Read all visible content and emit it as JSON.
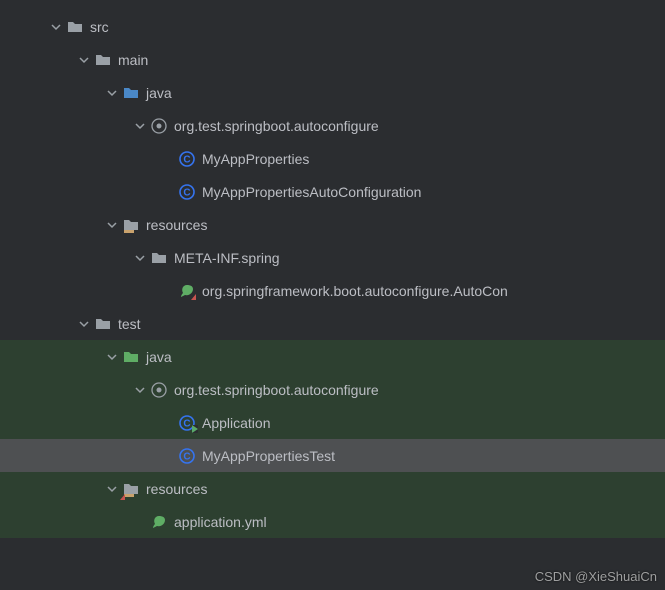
{
  "tree": {
    "src": "src",
    "main": "main",
    "main_java": "java",
    "main_pkg": "org.test.springboot.autoconfigure",
    "class_myappprops": "MyAppProperties",
    "class_myappautoconfig": "MyAppPropertiesAutoConfiguration",
    "resources": "resources",
    "metainf": "META-INF.spring",
    "autoconfig_file": "org.springframework.boot.autoconfigure.AutoCon",
    "test": "test",
    "test_java": "java",
    "test_pkg": "org.test.springboot.autoconfigure",
    "class_application": "Application",
    "class_myapptest": "MyAppPropertiesTest",
    "test_resources": "resources",
    "application_yml": "application.yml"
  },
  "watermark": "CSDN @XieShuaiCn"
}
